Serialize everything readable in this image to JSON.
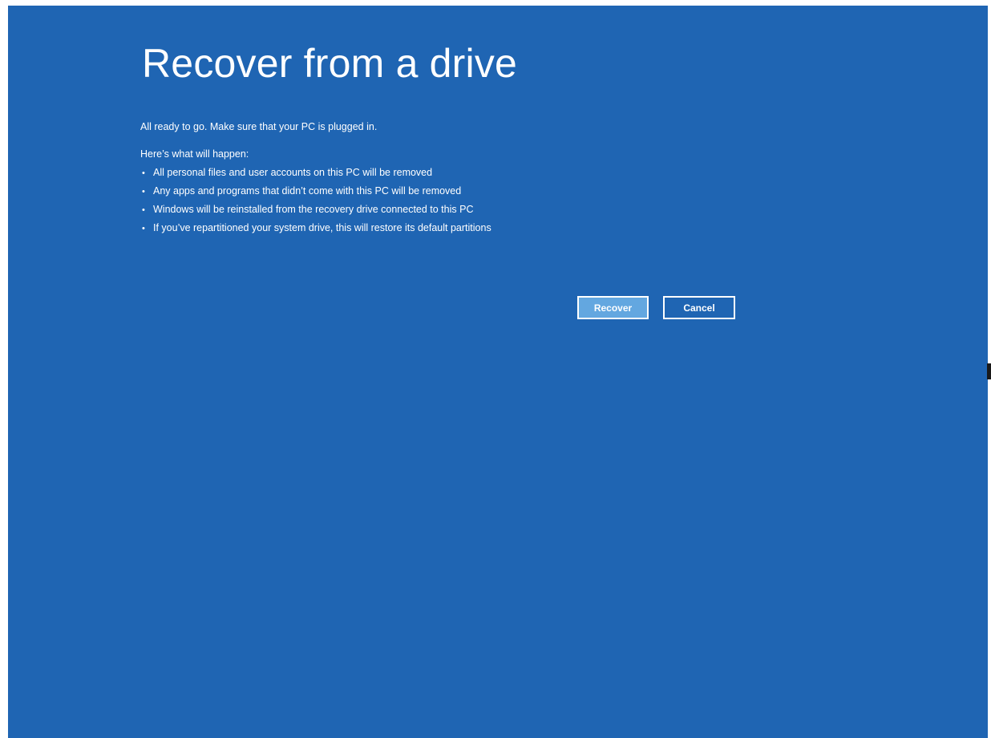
{
  "page": {
    "title": "Recover from a drive",
    "ready_message": "All ready to go. Make sure that your PC is plugged in.",
    "happen_heading": "Here’s what will happen:",
    "bullet_symbol": "•",
    "bullets": [
      "All personal files and user accounts on this PC will be removed",
      "Any apps and programs that didn’t come with this PC will be removed",
      "Windows will be reinstalled from the recovery drive connected to this PC",
      "If you’ve repartitioned your system drive, this will restore its default partitions"
    ]
  },
  "buttons": {
    "recover_label": "Recover",
    "cancel_label": "Cancel"
  },
  "colors": {
    "background": "#1f65b3",
    "primary_button": "#63a7e0",
    "text": "#ffffff"
  }
}
